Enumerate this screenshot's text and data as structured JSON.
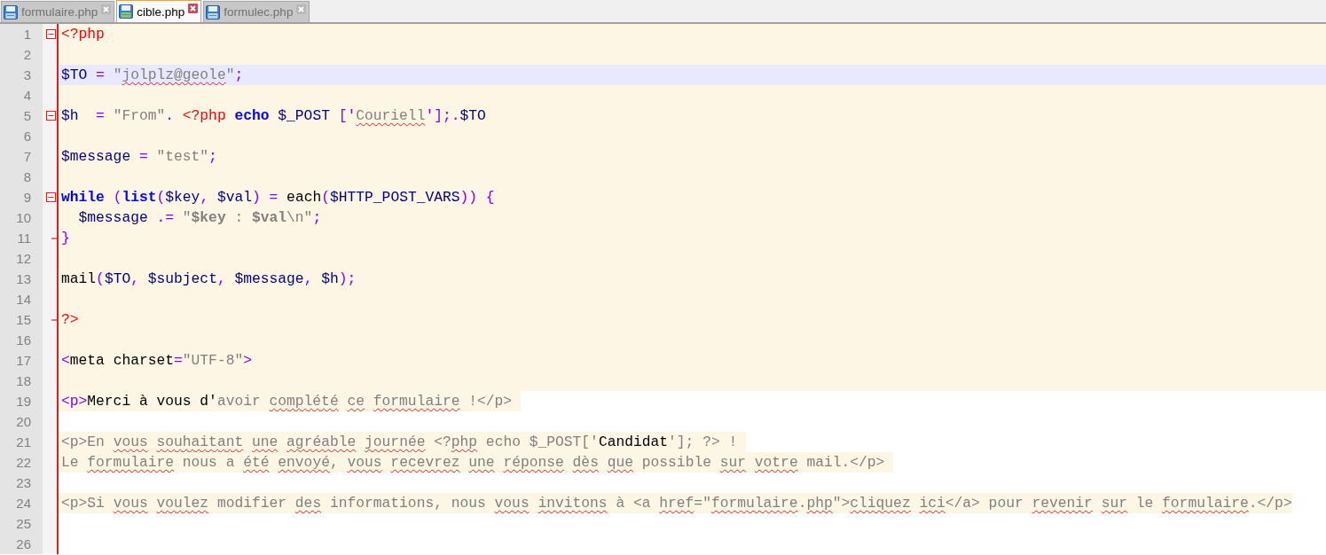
{
  "tabs": [
    {
      "label": "formulaire.php",
      "selected": false
    },
    {
      "label": "cible.php",
      "selected": true
    },
    {
      "label": "formulec.php",
      "selected": false
    }
  ],
  "lines": [
    {
      "number": "1",
      "current": false,
      "fold_start": true,
      "fold_end": false,
      "php_block": true,
      "tokens": [
        {
          "kind": "php-tag",
          "text": "<?php"
        }
      ]
    },
    {
      "number": "2",
      "current": false,
      "fold_start": false,
      "fold_end": false,
      "php_block": true
    },
    {
      "number": "3",
      "current": true,
      "fold_start": false,
      "fold_end": false,
      "php_block": true,
      "tokens": [
        {
          "kind": "variable",
          "text": "$TO"
        },
        {
          "kind": "operator",
          "text": " = "
        },
        {
          "kind": "string",
          "text": "\""
        },
        {
          "kind": "misspelled",
          "text": "jolplz@geole"
        },
        {
          "kind": "string",
          "text": "\""
        },
        {
          "kind": "operator",
          "text": ";"
        }
      ]
    },
    {
      "number": "4",
      "current": false,
      "fold_start": false,
      "fold_end": false,
      "php_block": true
    },
    {
      "number": "5",
      "current": false,
      "fold_start": true,
      "fold_end": false,
      "php_block": true,
      "tokens": [
        {
          "kind": "variable",
          "text": "$h  "
        },
        {
          "kind": "operator",
          "text": "= "
        },
        {
          "kind": "string",
          "text": "\"From\""
        },
        {
          "kind": "operator",
          "text": ". "
        },
        {
          "kind": "php-tag",
          "text": "<?php "
        },
        {
          "kind": "keyword",
          "text": "echo "
        },
        {
          "kind": "variable",
          "text": "$_POST "
        },
        {
          "kind": "operator",
          "text": "['"
        },
        {
          "kind": "misspelled",
          "text": "Couriell"
        },
        {
          "kind": "operator",
          "text": "'];."
        },
        {
          "kind": "variable",
          "text": "$TO"
        }
      ]
    },
    {
      "number": "6",
      "current": false,
      "fold_start": false,
      "fold_end": false,
      "php_block": true
    },
    {
      "number": "7",
      "current": false,
      "fold_start": false,
      "fold_end": false,
      "php_block": true,
      "tokens": [
        {
          "kind": "variable",
          "text": "$message "
        },
        {
          "kind": "operator",
          "text": "= "
        },
        {
          "kind": "string",
          "text": "\"test\""
        },
        {
          "kind": "operator",
          "text": ";"
        }
      ]
    },
    {
      "number": "8",
      "current": false,
      "fold_start": false,
      "fold_end": false,
      "php_block": true
    },
    {
      "number": "9",
      "current": false,
      "fold_start": true,
      "fold_end": false,
      "php_block": true,
      "tokens": [
        {
          "kind": "keyword",
          "text": "while"
        },
        {
          "kind": "operator",
          "text": " ("
        },
        {
          "kind": "keyword",
          "text": "list"
        },
        {
          "kind": "operator",
          "text": "("
        },
        {
          "kind": "variable",
          "text": "$key"
        },
        {
          "kind": "operator",
          "text": ", "
        },
        {
          "kind": "variable",
          "text": "$val"
        },
        {
          "kind": "operator",
          "text": ") = "
        },
        {
          "kind": "plain",
          "text": "each"
        },
        {
          "kind": "operator",
          "text": "("
        },
        {
          "kind": "variable",
          "text": "$HTTP_POST_VARS"
        },
        {
          "kind": "operator",
          "text": ")) {"
        }
      ]
    },
    {
      "number": "10",
      "current": false,
      "fold_start": false,
      "fold_end": false,
      "php_block": true,
      "tokens": [
        {
          "kind": "variable",
          "text": "  $message "
        },
        {
          "kind": "operator",
          "text": ".= "
        },
        {
          "kind": "string",
          "text": "\""
        },
        {
          "kind": "string-bold",
          "text": "$key"
        },
        {
          "kind": "string",
          "text": " : "
        },
        {
          "kind": "string-bold",
          "text": "$val"
        },
        {
          "kind": "string",
          "text": "\\n\""
        },
        {
          "kind": "operator",
          "text": ";"
        }
      ]
    },
    {
      "number": "11",
      "current": false,
      "fold_start": false,
      "fold_end": true,
      "php_block": true,
      "tokens": [
        {
          "kind": "operator",
          "text": "}"
        }
      ]
    },
    {
      "number": "12",
      "current": false,
      "fold_start": false,
      "fold_end": false,
      "php_block": true
    },
    {
      "number": "13",
      "current": false,
      "fold_start": false,
      "fold_end": false,
      "php_block": true,
      "tokens": [
        {
          "kind": "plain",
          "text": "mail"
        },
        {
          "kind": "operator",
          "text": "("
        },
        {
          "kind": "variable",
          "text": "$TO"
        },
        {
          "kind": "operator",
          "text": ", "
        },
        {
          "kind": "variable",
          "text": "$subject"
        },
        {
          "kind": "operator",
          "text": ", "
        },
        {
          "kind": "variable",
          "text": "$message"
        },
        {
          "kind": "operator",
          "text": ", "
        },
        {
          "kind": "variable",
          "text": "$h"
        },
        {
          "kind": "operator",
          "text": ");"
        }
      ]
    },
    {
      "number": "14",
      "current": false,
      "fold_start": false,
      "fold_end": false,
      "php_block": true
    },
    {
      "number": "15",
      "current": false,
      "fold_start": false,
      "fold_end": true,
      "php_block": true,
      "tokens": [
        {
          "kind": "php-tag",
          "text": "?>"
        }
      ]
    },
    {
      "number": "16",
      "current": false,
      "fold_start": false,
      "fold_end": false,
      "php_block": true
    },
    {
      "number": "17",
      "current": false,
      "fold_start": false,
      "fold_end": false,
      "php_block": true,
      "tokens": [
        {
          "kind": "html-tag",
          "text": "<"
        },
        {
          "kind": "plain",
          "text": "meta charset"
        },
        {
          "kind": "html-tag",
          "text": "="
        },
        {
          "kind": "string",
          "text": "\"UTF-8\""
        },
        {
          "kind": "html-tag",
          "text": ">"
        }
      ]
    },
    {
      "number": "18",
      "current": false,
      "fold_start": false,
      "fold_end": false,
      "php_block": true
    },
    {
      "number": "19",
      "current": false,
      "fold_start": false,
      "fold_end": false,
      "php_block": false,
      "tokens": [
        {
          "kind": "html-tag",
          "text": "<p>"
        },
        {
          "kind": "plain",
          "text": "Merci à vous d'"
        },
        {
          "kind": "string",
          "text": "avoir "
        },
        {
          "kind": "misspelled",
          "text": "complété "
        },
        {
          "kind": "misspelled",
          "text": "ce "
        },
        {
          "kind": "misspelled",
          "text": "formulaire "
        },
        {
          "kind": "string",
          "text": "!</p> "
        }
      ]
    },
    {
      "number": "20",
      "current": false,
      "fold_start": false,
      "fold_end": false,
      "php_block": false
    },
    {
      "number": "21",
      "current": false,
      "fold_start": false,
      "fold_end": false,
      "php_block": false,
      "tokens": [
        {
          "kind": "string",
          "text": "<p>En "
        },
        {
          "kind": "misspelled",
          "text": "vous "
        },
        {
          "kind": "misspelled",
          "text": "souhaitant "
        },
        {
          "kind": "misspelled",
          "text": "une "
        },
        {
          "kind": "misspelled",
          "text": "agréable "
        },
        {
          "kind": "misspelled",
          "text": "journée "
        },
        {
          "kind": "string",
          "text": "<?"
        },
        {
          "kind": "misspelled",
          "text": "php"
        },
        {
          "kind": "string",
          "text": " echo $_POST['"
        },
        {
          "kind": "plain",
          "text": "Candidat"
        },
        {
          "kind": "string",
          "text": "']; ?> ! "
        }
      ]
    },
    {
      "number": "22",
      "current": false,
      "fold_start": false,
      "fold_end": false,
      "php_block": false,
      "tokens": [
        {
          "kind": "string",
          "text": "Le "
        },
        {
          "kind": "misspelled",
          "text": "formulaire "
        },
        {
          "kind": "string",
          "text": "nous a "
        },
        {
          "kind": "misspelled",
          "text": "été "
        },
        {
          "kind": "misspelled",
          "text": "envoyé"
        },
        {
          "kind": "string",
          "text": ", "
        },
        {
          "kind": "misspelled",
          "text": "vous "
        },
        {
          "kind": "misspelled",
          "text": "recevrez "
        },
        {
          "kind": "misspelled",
          "text": "une "
        },
        {
          "kind": "misspelled",
          "text": "réponse "
        },
        {
          "kind": "misspelled",
          "text": "dès "
        },
        {
          "kind": "misspelled",
          "text": "que "
        },
        {
          "kind": "string",
          "text": "possible "
        },
        {
          "kind": "misspelled",
          "text": "sur "
        },
        {
          "kind": "misspelled",
          "text": "votre "
        },
        {
          "kind": "string",
          "text": "mail.</p> "
        }
      ]
    },
    {
      "number": "23",
      "current": false,
      "fold_start": false,
      "fold_end": false,
      "php_block": false
    },
    {
      "number": "24",
      "current": false,
      "fold_start": false,
      "fold_end": false,
      "php_block": false,
      "tokens": [
        {
          "kind": "string",
          "text": "<p>Si "
        },
        {
          "kind": "misspelled",
          "text": "vous "
        },
        {
          "kind": "misspelled",
          "text": "voulez "
        },
        {
          "kind": "string",
          "text": "modifier "
        },
        {
          "kind": "misspelled",
          "text": "des "
        },
        {
          "kind": "string",
          "text": "informations, nous "
        },
        {
          "kind": "misspelled",
          "text": "vous "
        },
        {
          "kind": "misspelled",
          "text": "invitons "
        },
        {
          "kind": "string",
          "text": "à <a "
        },
        {
          "kind": "misspelled",
          "text": "href"
        },
        {
          "kind": "string",
          "text": "=\""
        },
        {
          "kind": "misspelled",
          "text": "formulaire"
        },
        {
          "kind": "string",
          "text": "."
        },
        {
          "kind": "misspelled",
          "text": "php"
        },
        {
          "kind": "string",
          "text": "\">"
        },
        {
          "kind": "misspelled",
          "text": "cliquez "
        },
        {
          "kind": "misspelled",
          "text": "ici"
        },
        {
          "kind": "string",
          "text": "</a> pour "
        },
        {
          "kind": "misspelled",
          "text": "revenir "
        },
        {
          "kind": "misspelled",
          "text": "sur "
        },
        {
          "kind": "string",
          "text": "le "
        },
        {
          "kind": "misspelled",
          "text": "formulaire"
        },
        {
          "kind": "string",
          "text": ".</p>"
        }
      ]
    },
    {
      "number": "25",
      "current": false,
      "fold_start": false,
      "fold_end": false,
      "php_block": false
    },
    {
      "number": "26",
      "current": false,
      "fold_start": false,
      "fold_end": false,
      "php_block": false
    }
  ]
}
